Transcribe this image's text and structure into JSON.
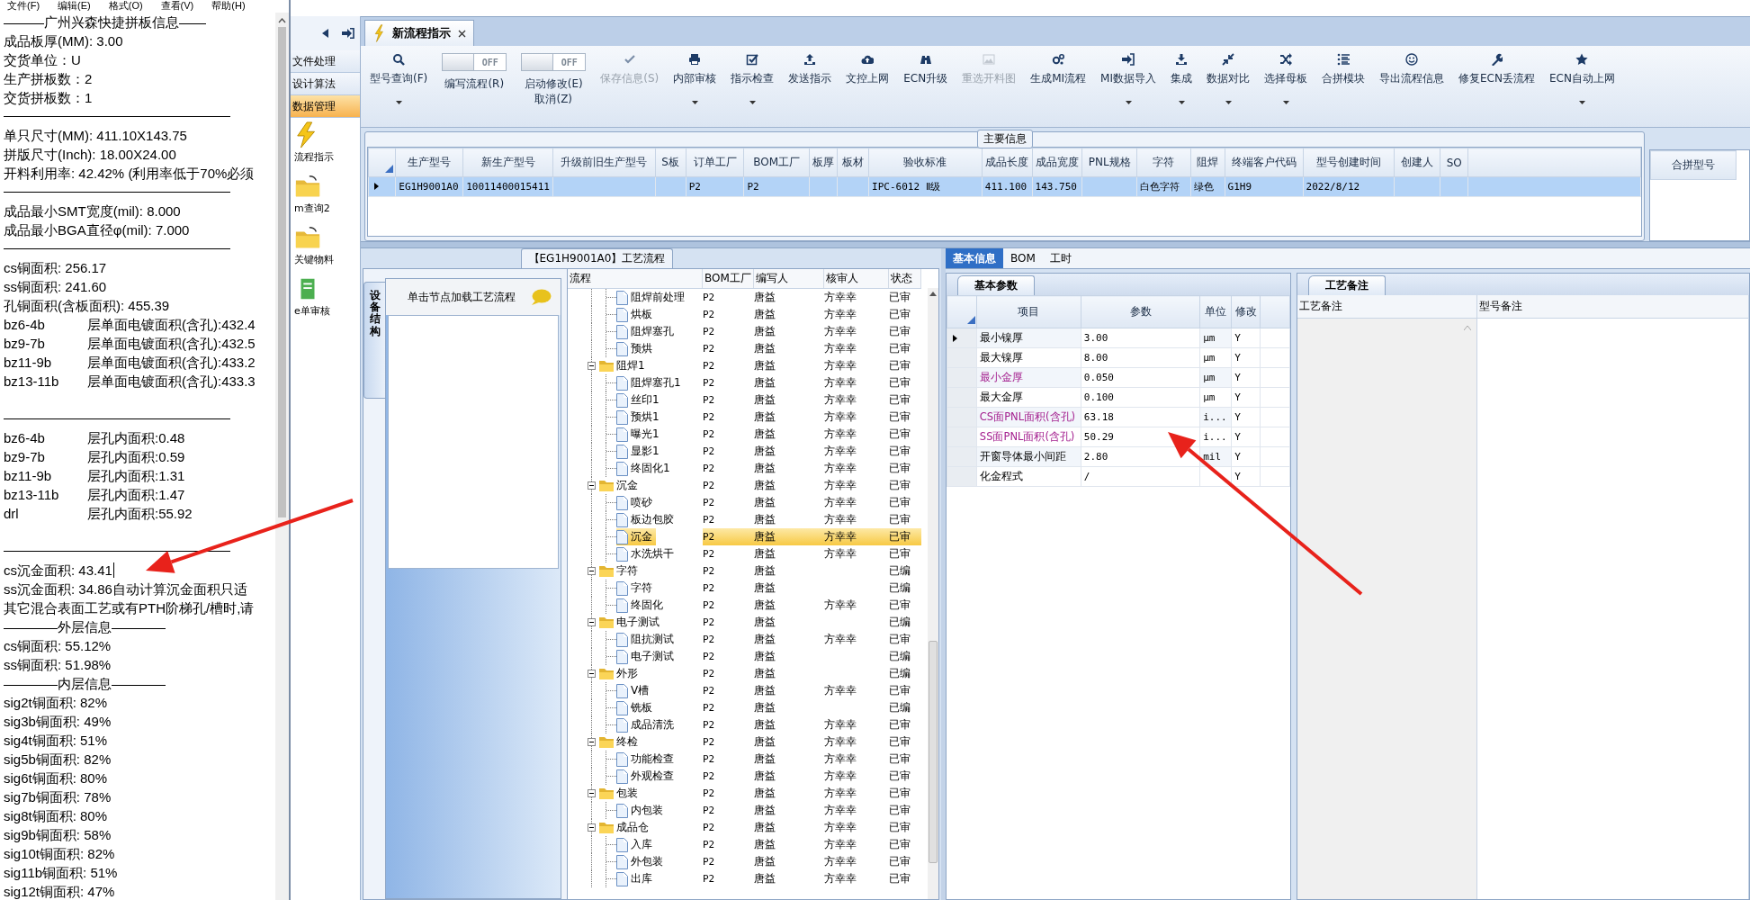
{
  "notepad": {
    "menu": [
      "文件(F)",
      "编辑(E)",
      "格式(O)",
      "查看(V)",
      "帮助(H)"
    ],
    "lines": [
      {
        "kind": "text",
        "text": "———广州兴森快捷拼板信息——"
      },
      {
        "kind": "text",
        "text": "成品板厚(MM): 3.00"
      },
      {
        "kind": "text",
        "text": "交货单位：U"
      },
      {
        "kind": "text",
        "text": "生产拼板数：2"
      },
      {
        "kind": "text",
        "text": "交货拼板数：1"
      },
      {
        "kind": "rule"
      },
      {
        "kind": "text",
        "text": "单只尺寸(MM): 411.10X143.75"
      },
      {
        "kind": "text",
        "text": "拼版尺寸(Inch): 18.00X24.00"
      },
      {
        "kind": "text",
        "text": "开料利用率: 42.42% (利用率低于70%必须"
      },
      {
        "kind": "rule"
      },
      {
        "kind": "text",
        "text": "成品最小SMT宽度(mil): 8.000"
      },
      {
        "kind": "text",
        "text": "成品最小BGA直径φ(mil):  7.000"
      },
      {
        "kind": "rule"
      },
      {
        "kind": "text",
        "text": "cs铜面积: 256.17"
      },
      {
        "kind": "text",
        "text": "ss铜面积: 241.60"
      },
      {
        "kind": "text",
        "text": "孔铜面积(含板面积): 455.39"
      },
      {
        "kind": "pair",
        "parts": [
          "bz6-4b",
          "层单面电镀面积(含孔):432.4"
        ]
      },
      {
        "kind": "pair",
        "parts": [
          "bz9-7b",
          "层单面电镀面积(含孔):432.5"
        ]
      },
      {
        "kind": "pair",
        "parts": [
          "bz11-9b",
          "层单面电镀面积(含孔):433.2"
        ]
      },
      {
        "kind": "pair",
        "parts": [
          "bz13-11b",
          "层单面电镀面积(含孔):433.3"
        ]
      },
      {
        "kind": "blank"
      },
      {
        "kind": "rule"
      },
      {
        "kind": "pair",
        "parts": [
          "bz6-4b",
          "层孔内面积:0.48"
        ]
      },
      {
        "kind": "pair",
        "parts": [
          "bz9-7b",
          "层孔内面积:0.59"
        ]
      },
      {
        "kind": "pair",
        "parts": [
          "bz11-9b",
          "层孔内面积:1.31"
        ]
      },
      {
        "kind": "pair",
        "parts": [
          "bz13-11b",
          "层孔内面积:1.47"
        ]
      },
      {
        "kind": "pair",
        "parts": [
          "drl",
          "层孔内面积:55.92"
        ]
      },
      {
        "kind": "blank"
      },
      {
        "kind": "rule"
      },
      {
        "kind": "text",
        "text": "cs沉金面积: 43.41",
        "caret": true
      },
      {
        "kind": "text",
        "text": "ss沉金面积: 34.86自动计算沉金面积只适"
      },
      {
        "kind": "text",
        "text": "其它混合表面工艺或有PTH阶梯孔/槽时,请"
      },
      {
        "kind": "text",
        "text": "————外层信息————"
      },
      {
        "kind": "text",
        "text": "cs铜面积: 55.12%"
      },
      {
        "kind": "text",
        "text": "ss铜面积: 51.98%"
      },
      {
        "kind": "text",
        "text": "————内层信息————"
      },
      {
        "kind": "text",
        "text": "sig2t铜面积: 82%"
      },
      {
        "kind": "text",
        "text": "sig3b铜面积: 49%"
      },
      {
        "kind": "text",
        "text": "sig4t铜面积: 51%"
      },
      {
        "kind": "text",
        "text": "sig5b铜面积: 82%"
      },
      {
        "kind": "text",
        "text": "sig6t铜面积: 80%"
      },
      {
        "kind": "text",
        "text": "sig7b铜面积: 78%"
      },
      {
        "kind": "text",
        "text": "sig8t铜面积: 80%"
      },
      {
        "kind": "text",
        "text": "sig9b铜面积: 58%"
      },
      {
        "kind": "text",
        "text": "sig10t铜面积: 82%"
      },
      {
        "kind": "text",
        "text": "sig11b铜面积: 51%"
      },
      {
        "kind": "text",
        "text": "sig12t铜面积: 47%"
      }
    ]
  },
  "nav": {
    "items": [
      {
        "label": "文件处理",
        "selected": false
      },
      {
        "label": "设计算法",
        "selected": false
      },
      {
        "label": "数据管理",
        "selected": true
      }
    ],
    "shortcuts": [
      {
        "label": "流程指示"
      },
      {
        "label": "m查询2"
      },
      {
        "label": "关键物料"
      },
      {
        "label": "e单审核"
      }
    ]
  },
  "document_tabs": [
    {
      "label": "新流程指示",
      "selected": true,
      "closable": true
    }
  ],
  "toolbar": [
    {
      "kind": "button",
      "label": "型号查询(F)",
      "dropdown": true,
      "disabled": false
    },
    {
      "kind": "toggle",
      "label": "编写流程(R)",
      "state_text": "OFF",
      "on": false
    },
    {
      "kind": "toggle",
      "label": "启动修改(E)\n取消(Z)",
      "state_text": "OFF",
      "on": false
    },
    {
      "kind": "button",
      "label": "保存信息(S)",
      "dropdown": false,
      "disabled": true
    },
    {
      "kind": "button",
      "label": "内部审核",
      "dropdown": true,
      "disabled": false
    },
    {
      "kind": "button",
      "label": "指示检查",
      "dropdown": true,
      "disabled": false
    },
    {
      "kind": "button",
      "label": "发送指示",
      "dropdown": false,
      "disabled": false
    },
    {
      "kind": "button",
      "label": "文控上网",
      "dropdown": false,
      "disabled": false
    },
    {
      "kind": "button",
      "label": "ECN升级",
      "dropdown": false,
      "disabled": false
    },
    {
      "kind": "button",
      "label": "重选开料图",
      "dropdown": false,
      "disabled": true
    },
    {
      "kind": "button",
      "label": "生成MI流程",
      "dropdown": false,
      "disabled": false
    },
    {
      "kind": "button",
      "label": "MI数据导入",
      "dropdown": true,
      "disabled": false
    },
    {
      "kind": "button",
      "label": "集成",
      "dropdown": true,
      "disabled": false
    },
    {
      "kind": "button",
      "label": "数据对比",
      "dropdown": true,
      "disabled": false
    },
    {
      "kind": "button",
      "label": "选择母板",
      "dropdown": true,
      "disabled": false
    },
    {
      "kind": "button",
      "label": "合拼模块",
      "dropdown": false,
      "disabled": false
    },
    {
      "kind": "button",
      "label": "导出流程信息",
      "dropdown": false,
      "disabled": false
    },
    {
      "kind": "button",
      "label": "修复ECN丢流程",
      "dropdown": false,
      "disabled": false
    },
    {
      "kind": "button",
      "label": "ECN自动上网",
      "dropdown": true,
      "disabled": false
    }
  ],
  "main_info": {
    "title": "主要信息",
    "columns": [
      "生产型号",
      "新生产型号",
      "升级前旧生产型号",
      "S板",
      "订单工厂",
      "BOM工厂",
      "板厚",
      "板材",
      "验收标准",
      "成品长度",
      "成品宽度",
      "PNL规格",
      "字符",
      "阻焊",
      "终端客户代码",
      "型号创建时间",
      "创建人",
      "SO"
    ],
    "rows": [
      {
        "selected": true,
        "cells": [
          "EG1H9001A0",
          "10011400015411",
          null,
          null,
          "P2",
          "P2",
          null,
          null,
          "IPC-6012 Ⅱ级",
          "411.100",
          "143.750",
          null,
          "白色字符",
          "绿色",
          "G1H9",
          "2022/8/12",
          null,
          null
        ]
      }
    ],
    "merge_panel": {
      "columns": [
        "合拼型号"
      ]
    }
  },
  "flow": {
    "title": "【EG1H9001A0】工艺流程",
    "side_tab": "设备结构",
    "hint": "单击节点加载工艺流程",
    "columns": [
      "流程",
      "BOM工厂",
      "编写人",
      "核审人",
      "状态"
    ],
    "rows": [
      {
        "children": [
          {
            "kind": "step",
            "label": "阻焊前处理",
            "bom_factory": "P2",
            "writer": "唐益",
            "reviewer": "方幸幸",
            "status": "已审",
            "selected": false
          },
          {
            "kind": "step",
            "label": "烘板",
            "bom_factory": "P2",
            "writer": "唐益",
            "reviewer": "方幸幸",
            "status": "已审",
            "selected": false
          },
          {
            "kind": "step",
            "label": "阻焊塞孔",
            "bom_factory": "P2",
            "writer": "唐益",
            "reviewer": "方幸幸",
            "status": "已审",
            "selected": false
          },
          {
            "kind": "step",
            "label": "预烘",
            "bom_factory": "P2",
            "writer": "唐益",
            "reviewer": "方幸幸",
            "status": "已审",
            "selected": false
          }
        ]
      },
      {
        "kind": "folder",
        "label": "阻焊1",
        "bom_factory": "P2",
        "writer": "唐益",
        "reviewer": "方幸幸",
        "status": "已审",
        "expanded": true,
        "selected": false,
        "children": [
          {
            "kind": "step",
            "label": "阻焊塞孔1",
            "bom_factory": "P2",
            "writer": "唐益",
            "reviewer": "方幸幸",
            "status": "已审",
            "selected": false
          },
          {
            "kind": "step",
            "label": "丝印1",
            "bom_factory": "P2",
            "writer": "唐益",
            "reviewer": "方幸幸",
            "status": "已审",
            "selected": false
          },
          {
            "kind": "step",
            "label": "预烘1",
            "bom_factory": "P2",
            "writer": "唐益",
            "reviewer": "方幸幸",
            "status": "已审",
            "selected": false
          },
          {
            "kind": "step",
            "label": "曝光1",
            "bom_factory": "P2",
            "writer": "唐益",
            "reviewer": "方幸幸",
            "status": "已审",
            "selected": false
          },
          {
            "kind": "step",
            "label": "显影1",
            "bom_factory": "P2",
            "writer": "唐益",
            "reviewer": "方幸幸",
            "status": "已审",
            "selected": false
          },
          {
            "kind": "step",
            "label": "终固化1",
            "bom_factory": "P2",
            "writer": "唐益",
            "reviewer": "方幸幸",
            "status": "已审",
            "selected": false
          }
        ]
      },
      {
        "kind": "folder",
        "label": "沉金",
        "bom_factory": "P2",
        "writer": "唐益",
        "reviewer": "方幸幸",
        "status": "已审",
        "expanded": true,
        "selected": false,
        "children": [
          {
            "kind": "step",
            "label": "喷砂",
            "bom_factory": "P2",
            "writer": "唐益",
            "reviewer": "方幸幸",
            "status": "已审",
            "selected": false
          },
          {
            "kind": "step",
            "label": "板边包胶",
            "bom_factory": "P2",
            "writer": "唐益",
            "reviewer": "方幸幸",
            "status": "已审",
            "selected": false
          },
          {
            "kind": "step",
            "label": "沉金",
            "bom_factory": "P2",
            "writer": "唐益",
            "reviewer": "方幸幸",
            "status": "已审",
            "selected": true
          },
          {
            "kind": "step",
            "label": "水洗烘干",
            "bom_factory": "P2",
            "writer": "唐益",
            "reviewer": "方幸幸",
            "status": "已审",
            "selected": false
          }
        ]
      },
      {
        "kind": "folder",
        "label": "字符",
        "bom_factory": "P2",
        "writer": "唐益",
        "status": "已编",
        "expanded": true,
        "selected": false,
        "children": [
          {
            "kind": "step",
            "label": "字符",
            "bom_factory": "P2",
            "writer": "唐益",
            "status": "已编",
            "selected": false
          },
          {
            "kind": "step",
            "label": "终固化",
            "bom_factory": "P2",
            "writer": "唐益",
            "reviewer": "方幸幸",
            "status": "已审",
            "selected": false
          }
        ]
      },
      {
        "kind": "folder",
        "label": "电子测试",
        "bom_factory": "P2",
        "writer": "唐益",
        "status": "已编",
        "expanded": true,
        "selected": false,
        "children": [
          {
            "kind": "step",
            "label": "阻抗测试",
            "bom_factory": "P2",
            "writer": "唐益",
            "reviewer": "方幸幸",
            "status": "已审",
            "selected": false
          },
          {
            "kind": "step",
            "label": "电子测试",
            "bom_factory": "P2",
            "writer": "唐益",
            "status": "已编",
            "selected": false
          }
        ]
      },
      {
        "kind": "folder",
        "label": "外形",
        "bom_factory": "P2",
        "writer": "唐益",
        "status": "已编",
        "expanded": true,
        "selected": false,
        "children": [
          {
            "kind": "step",
            "label": "V槽",
            "bom_factory": "P2",
            "writer": "唐益",
            "reviewer": "方幸幸",
            "status": "已审",
            "selected": false
          },
          {
            "kind": "step",
            "label": "铣板",
            "bom_factory": "P2",
            "writer": "唐益",
            "status": "已编",
            "selected": false
          },
          {
            "kind": "step",
            "label": "成品清洗",
            "bom_factory": "P2",
            "writer": "唐益",
            "reviewer": "方幸幸",
            "status": "已审",
            "selected": false
          }
        ]
      },
      {
        "kind": "folder",
        "label": "终检",
        "bom_factory": "P2",
        "writer": "唐益",
        "reviewer": "方幸幸",
        "status": "已审",
        "expanded": true,
        "selected": false,
        "children": [
          {
            "kind": "step",
            "label": "功能检查",
            "bom_factory": "P2",
            "writer": "唐益",
            "reviewer": "方幸幸",
            "status": "已审",
            "selected": false
          },
          {
            "kind": "step",
            "label": "外观检查",
            "bom_factory": "P2",
            "writer": "唐益",
            "reviewer": "方幸幸",
            "status": "已审",
            "selected": false
          }
        ]
      },
      {
        "kind": "folder",
        "label": "包装",
        "bom_factory": "P2",
        "writer": "唐益",
        "reviewer": "方幸幸",
        "status": "已审",
        "expanded": true,
        "selected": false,
        "children": [
          {
            "kind": "step",
            "label": "内包装",
            "bom_factory": "P2",
            "writer": "唐益",
            "reviewer": "方幸幸",
            "status": "已审",
            "selected": false
          }
        ]
      },
      {
        "kind": "folder",
        "label": "成品仓",
        "bom_factory": "P2",
        "writer": "唐益",
        "reviewer": "方幸幸",
        "status": "已审",
        "expanded": true,
        "selected": false,
        "children": [
          {
            "kind": "step",
            "label": "入库",
            "bom_factory": "P2",
            "writer": "唐益",
            "reviewer": "方幸幸",
            "status": "已审",
            "selected": false
          },
          {
            "kind": "step",
            "label": "外包装",
            "bom_factory": "P2",
            "writer": "唐益",
            "reviewer": "方幸幸",
            "status": "已审",
            "selected": false
          },
          {
            "kind": "step",
            "label": "出库",
            "bom_factory": "P2",
            "writer": "唐益",
            "reviewer": "方幸幸",
            "status": "已审",
            "selected": false
          }
        ]
      }
    ]
  },
  "details": {
    "tabs": [
      {
        "label": "基本信息",
        "selected": true
      },
      {
        "label": "BOM",
        "selected": false
      },
      {
        "label": "工时",
        "selected": false
      }
    ],
    "params": {
      "tab": "基本参数",
      "columns": [
        "项目",
        "参数",
        "单位",
        "修改"
      ],
      "rows": [
        {
          "item": "最小镍厚",
          "value": "3.00",
          "unit": "μm",
          "modified": "Y",
          "highlighted": false,
          "selected": true
        },
        {
          "item": "最大镍厚",
          "value": "8.00",
          "unit": "μm",
          "modified": "Y",
          "highlighted": false,
          "selected": false
        },
        {
          "item": "最小金厚",
          "value": "0.050",
          "unit": "μm",
          "modified": "Y",
          "highlighted": true,
          "selected": false
        },
        {
          "item": "最大金厚",
          "value": "0.100",
          "unit": "μm",
          "modified": "Y",
          "highlighted": false,
          "selected": false
        },
        {
          "item": "CS面PNL面积(含孔)",
          "value": "63.18",
          "unit": "i...",
          "modified": "Y",
          "highlighted": true,
          "selected": false
        },
        {
          "item": "SS面PNL面积(含孔)",
          "value": "50.29",
          "unit": "i...",
          "modified": "Y",
          "highlighted": true,
          "selected": false
        },
        {
          "item": "开窗导体最小间距",
          "value": "2.80",
          "unit": "mil",
          "modified": "Y",
          "highlighted": false,
          "selected": false
        },
        {
          "item": "化金程式",
          "value": "/",
          "modified": "Y",
          "highlighted": false,
          "selected": false
        }
      ]
    },
    "notes": {
      "tab": "工艺备注",
      "columns": [
        "工艺备注",
        "型号备注"
      ]
    }
  },
  "annotations": [
    {
      "kind": "arrow"
    },
    {
      "kind": "arrow"
    }
  ]
}
